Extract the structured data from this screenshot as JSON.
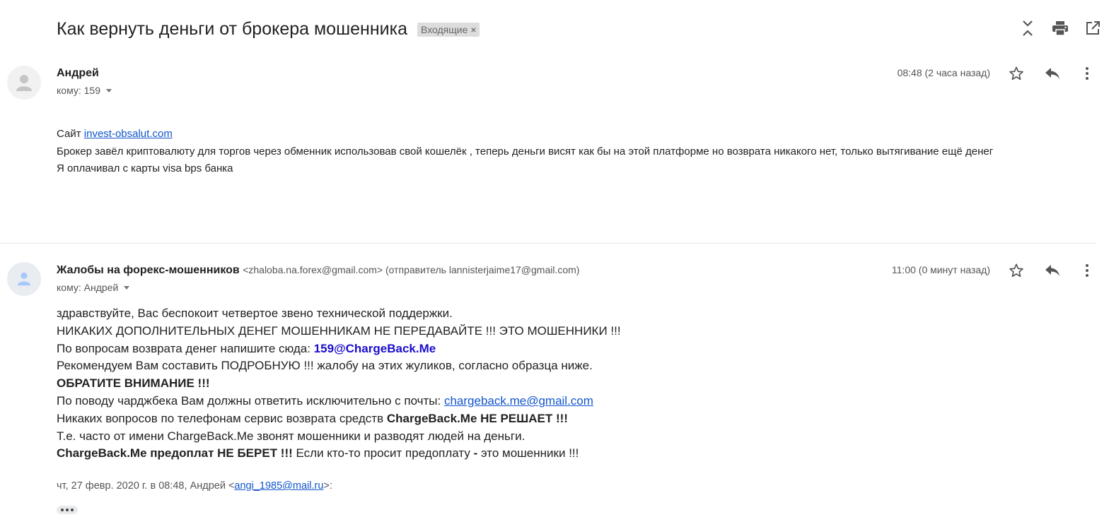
{
  "subject": "Как вернуть деньги от брокера мошенника",
  "label": "Входящие",
  "label_close": "×",
  "toolbar_icons": [
    "expand-collapse-icon",
    "print-icon",
    "open-new-window-icon"
  ],
  "messages": [
    {
      "sender_name": "Андрей",
      "to": "кому: 159",
      "time": "08:48 (2 часа назад)",
      "body": {
        "line1_prefix": "Сайт ",
        "line1_link": "invest-obsalut.com",
        "line2": "Брокер завёл криптовалюту для торгов через обменник использовав свой кошелёк , теперь деньги висят как бы на этой платформе но возврата никакого нет, только вытягивание ещё денег",
        "line3": "Я оплачивал с карты visa bps банка"
      }
    },
    {
      "sender_name": "Жалобы на форекс-мошенников",
      "sender_email": "<zhaloba.na.forex@gmail.com> (отправитель lannisterjaime17@gmail.com)",
      "to": "кому: Андрей",
      "time": "11:00 (0 минут назад)",
      "body": {
        "l1": "здравствуйте, Вас беспокоит четвертое звено технической поддержки.",
        "l2": "НИКАКИХ ДОПОЛНИТЕЛЬНЫХ ДЕНЕГ МОШЕННИКАМ НЕ ПЕРЕДАВАЙТЕ !!! ЭТО МОШЕННИКИ !!!",
        "l3_prefix": "По вопросам возврата денег напишите сюда: ",
        "l3_email": "159@ChargeBack.Me",
        "l4": "Рекомендуем Вам составить ПОДРОБНУЮ !!! жалобу на этих жуликов, согласно образца ниже.",
        "l5": "ОБРАТИТЕ ВНИМАНИЕ !!!",
        "l6_prefix": "По поводу чарджбека Вам должны ответить исключительно с почты: ",
        "l6_link": "chargeback.me@gmail.com",
        "l7_prefix": "Никаких вопросов по телефонам сервис возврата средств ",
        "l7_bold": "ChargeBack.Me НЕ РЕШАЕТ !!!",
        "l8": "Т.е. часто от имени ChargeBack.Me звонят мошенники и разводят людей на деньги.",
        "l9_bold": "ChargeBack.Me предоплат НЕ БЕРЕТ !!!",
        "l9_mid": " Если кто-то просит предоплату ",
        "l9_dash": "-",
        "l9_end": " это мошенники !!!"
      },
      "quote_prefix": "чт, 27 февр. 2020 г. в 08:48, Андрей <",
      "quote_link": "angi_1985@mail.ru",
      "quote_suffix": ">:"
    }
  ],
  "colors": {
    "link": "#1155cc",
    "email_highlight": "#1a0dcc",
    "chip_bg": "#dddddd"
  }
}
